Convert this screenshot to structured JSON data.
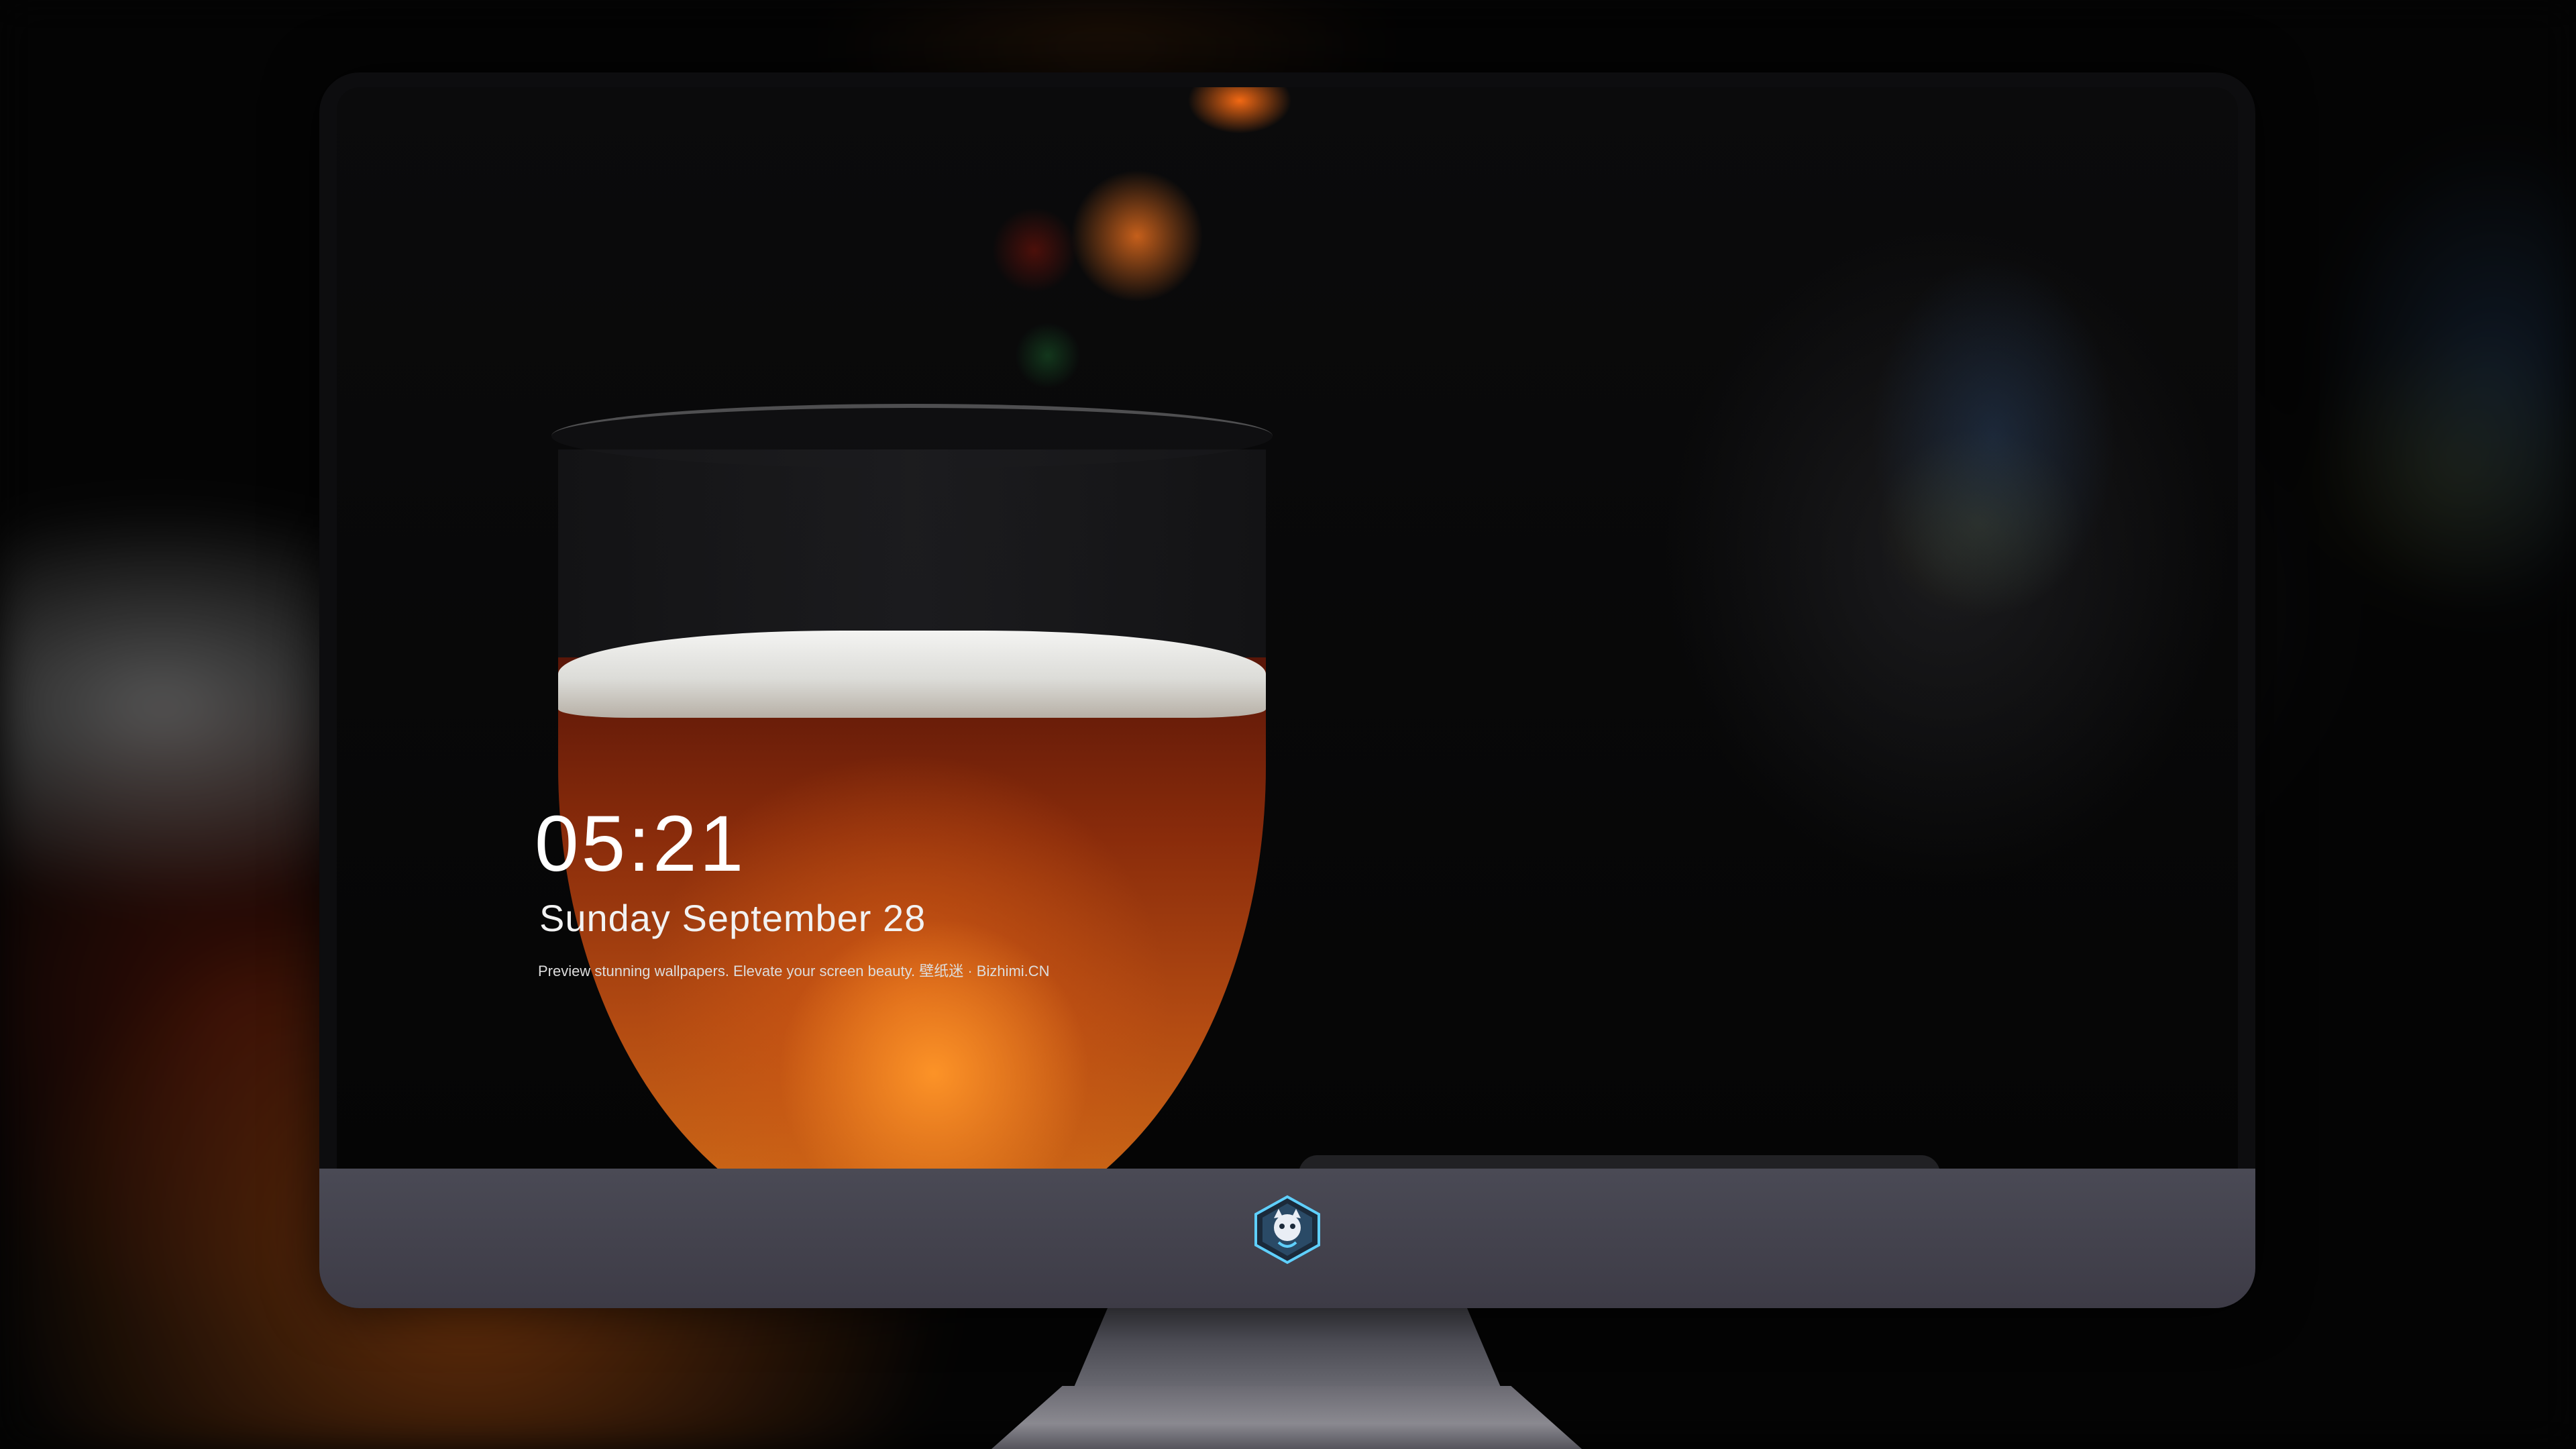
{
  "lockscreen": {
    "time": "05:21",
    "date": "Sunday September  28",
    "tagline": "Preview stunning wallpapers. Elevate your screen beauty. 壁纸迷 · Bizhimi.CN"
  },
  "dock": {
    "apps": [
      {
        "name": "messages-icon",
        "color": "#34c759"
      },
      {
        "name": "weather-icon",
        "color": "#2e8cf0"
      },
      {
        "name": "clock-icon",
        "color": "#ffffff"
      },
      {
        "name": "preview-icon",
        "color": "#f3c640"
      },
      {
        "name": "clips-icon",
        "color": "#59c8e8"
      },
      {
        "name": "notes-icon",
        "color": "#ffd23f"
      },
      {
        "name": "photo-booth-icon",
        "color": "#e84c3d"
      },
      {
        "name": "itunes-icon",
        "color": "#e94ce0"
      },
      {
        "name": "app-store-icon",
        "color": "#1f8ef1"
      },
      {
        "name": "camera-icon",
        "color": "#8a8a8e"
      }
    ]
  },
  "monitor": {
    "chin_logo": "bizhimi-logo",
    "accent": "#ff7a1a"
  }
}
